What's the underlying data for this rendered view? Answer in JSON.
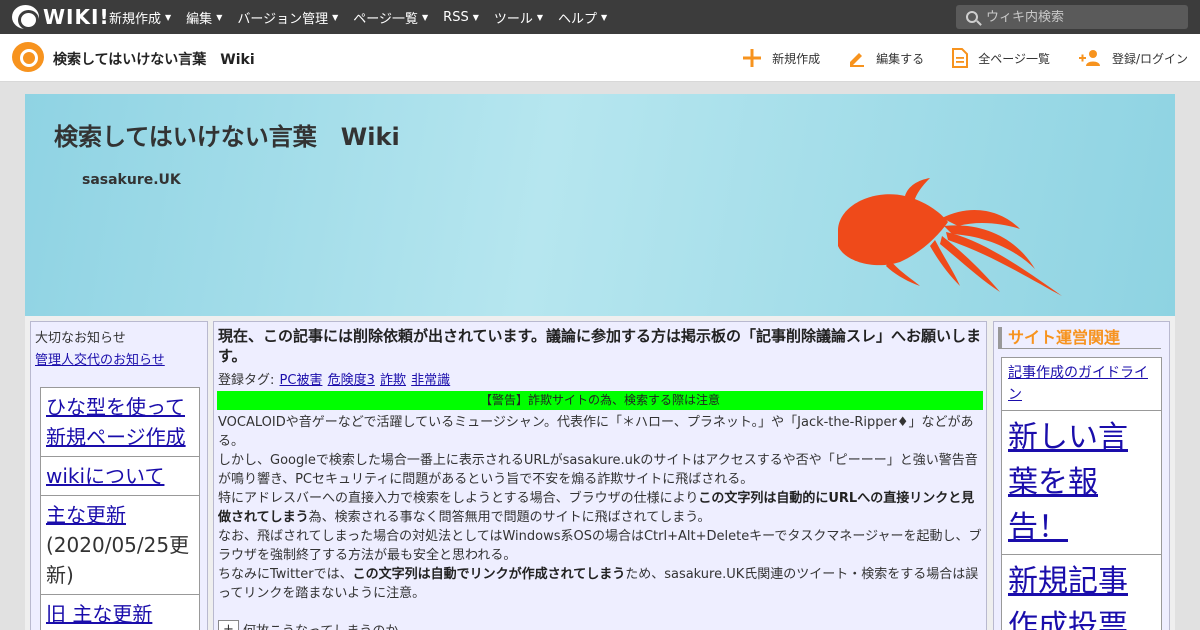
{
  "topbar": {
    "logo_text": "WIKI!",
    "menu": [
      "新規作成",
      "編集",
      "バージョン管理",
      "ページ一覧",
      "RSS",
      "ツール",
      "ヘルプ"
    ],
    "search_placeholder": "ウィキ内検索"
  },
  "sitebar": {
    "title": "検索してはいけない言葉　Wiki",
    "actions": [
      "新規作成",
      "編集する",
      "全ページ一覧",
      "登録/ログイン"
    ]
  },
  "banner": {
    "title": "検索してはいけない言葉　Wiki",
    "subtitle": "sasakure.UK"
  },
  "left": {
    "notice_title": "大切なお知らせ",
    "notice_link": "管理人交代のお知らせ",
    "nav": [
      {
        "text": "ひな型を使って新規ページ作成",
        "link": true
      },
      {
        "text": "wikiについて",
        "link": true
      },
      {
        "text": "主な更新",
        "link": true,
        "note": "(2020/05/25更新)"
      },
      {
        "text": "旧 主な更新",
        "link": true
      }
    ]
  },
  "main": {
    "title": "現在、この記事には削除依頼が出されています。議論に参加する方は掲示板の「記事削除議論スレ」へお願いします。",
    "tags_label": "登録タグ:",
    "tags": [
      "PC被害",
      "危険度3",
      "詐欺",
      "非常識"
    ],
    "warning": "【警告】詐欺サイトの為、検索する際は注意",
    "p1": "VOCALOIDや音ゲーなどで活躍しているミュージシャン。代表作に「＊ハロー、プラネット。」や「Jack-the-Ripper♦」などがある。",
    "p2": "しかし、Googleで検索した場合一番上に表示されるURLがsasakure.ukのサイトはアクセスするや否や「ピーーー」と強い警告音が鳴り響き、PCセキュリティに問題があるという旨で不安を煽る詐欺サイトに飛ばされる。",
    "p3_a": "特にアドレスバーへの直接入力で検索をしようとする場合、ブラウザの仕様により",
    "p3_b": "この文字列は自動的にURLへの直接リンクと見做されてしまう",
    "p3_c": "為、検索される事なく問答無用で問題のサイトに飛ばされてしまう。",
    "p4": "なお、飛ばされてしまった場合の対処法としてはWindows系OSの場合はCtrl+Alt+Deleteキーでタスクマネージャーを起動し、ブラウザを強制終了する方法が最も安全と思われる。",
    "p5_a": "ちなみにTwitterでは、",
    "p5_b": "この文字列は自動でリンクが作成されてしまう",
    "p5_c": "ため、sasakure.UK氏関連のツイート・検索をする場合は誤ってリンクを踏まないように注意。",
    "toggle_symbol": "+",
    "toggle_label": "何故こうなってしまうのか"
  },
  "right": {
    "heading": "サイト運営関連",
    "nav": [
      "記事作成のガイドライン",
      "新しい言葉を報告！",
      "新規記事作成投票"
    ]
  },
  "colors": {
    "accent": "#f7931e",
    "warning_bg": "#00ff00",
    "link": "#1a0dab",
    "fish": "#ef4a1a"
  }
}
